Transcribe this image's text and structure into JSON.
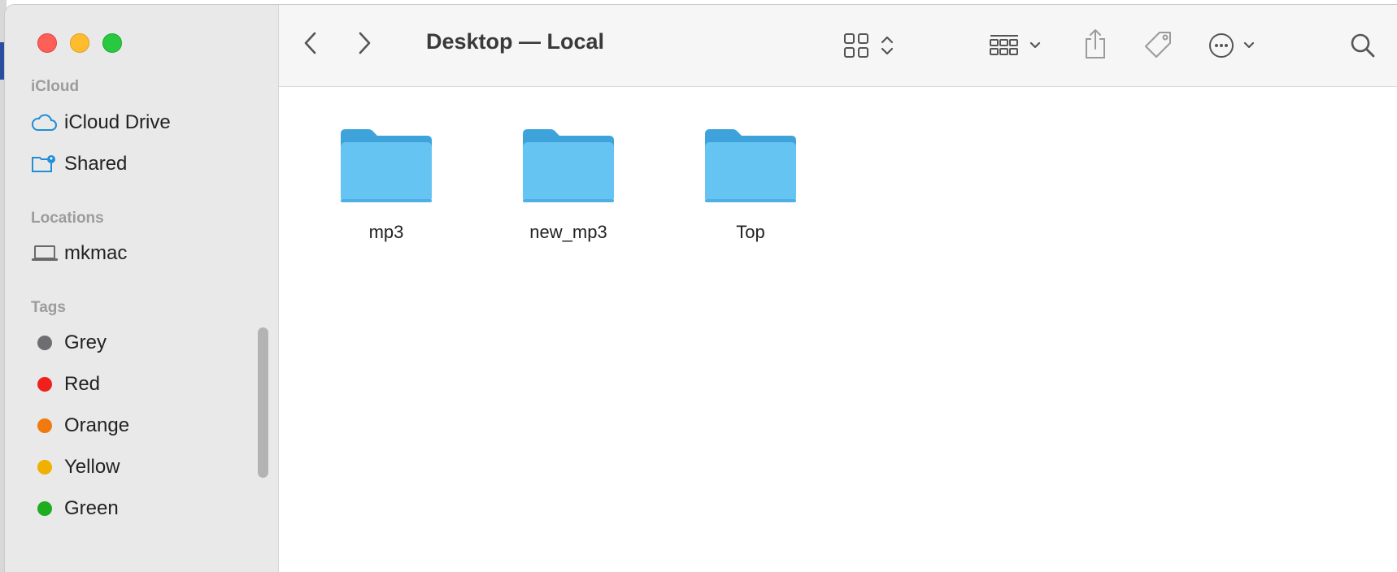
{
  "window": {
    "title": "Desktop — Local"
  },
  "sidebar": {
    "sections": [
      {
        "heading": "iCloud",
        "items": [
          {
            "label": "iCloud Drive",
            "icon": "cloud-icon"
          },
          {
            "label": "Shared",
            "icon": "shared-folder-icon"
          }
        ]
      },
      {
        "heading": "Locations",
        "items": [
          {
            "label": "mkmac",
            "icon": "laptop-icon"
          }
        ]
      },
      {
        "heading": "Tags",
        "items": [
          {
            "label": "Grey",
            "color": "#6e6e72"
          },
          {
            "label": "Red",
            "color": "#f0201d"
          },
          {
            "label": "Orange",
            "color": "#f07a10"
          },
          {
            "label": "Yellow",
            "color": "#efb000"
          },
          {
            "label": "Green",
            "color": "#1ead1e"
          }
        ]
      }
    ]
  },
  "toolbar": {
    "icons": [
      "back-icon",
      "forward-icon",
      "icon-view-icon",
      "group-icon",
      "share-icon",
      "tag-icon",
      "more-icon",
      "search-icon"
    ]
  },
  "files": [
    {
      "name": "mp3"
    },
    {
      "name": "new_mp3"
    },
    {
      "name": "Top"
    }
  ],
  "colors": {
    "folder": "#66c4f2",
    "folder_tab": "#3fa3db",
    "accent": "#0a84ff"
  }
}
